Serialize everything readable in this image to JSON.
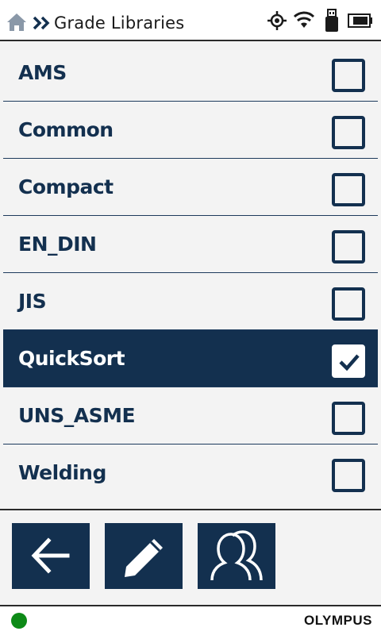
{
  "header": {
    "title": "Grade Libraries",
    "icons": [
      "home-icon",
      "chevrons-right-icon",
      "gps-icon",
      "wifi-icon",
      "usb-drive-icon",
      "battery-icon"
    ]
  },
  "library_list": {
    "items": [
      {
        "label": "AMS",
        "checked": false
      },
      {
        "label": "Common",
        "checked": false
      },
      {
        "label": "Compact",
        "checked": false
      },
      {
        "label": "EN_DIN",
        "checked": false
      },
      {
        "label": "JIS",
        "checked": false
      },
      {
        "label": "QuickSort",
        "checked": true
      },
      {
        "label": "UNS_ASME",
        "checked": false
      },
      {
        "label": "Welding",
        "checked": false
      }
    ]
  },
  "toolbar": {
    "buttons": [
      "back-arrow-icon",
      "pencil-icon",
      "users-icon"
    ]
  },
  "footer": {
    "status_color": "#0d8a17",
    "brand": "OLYMPUS"
  },
  "colors": {
    "primary": "#13304f",
    "background": "#f3f3f3"
  }
}
